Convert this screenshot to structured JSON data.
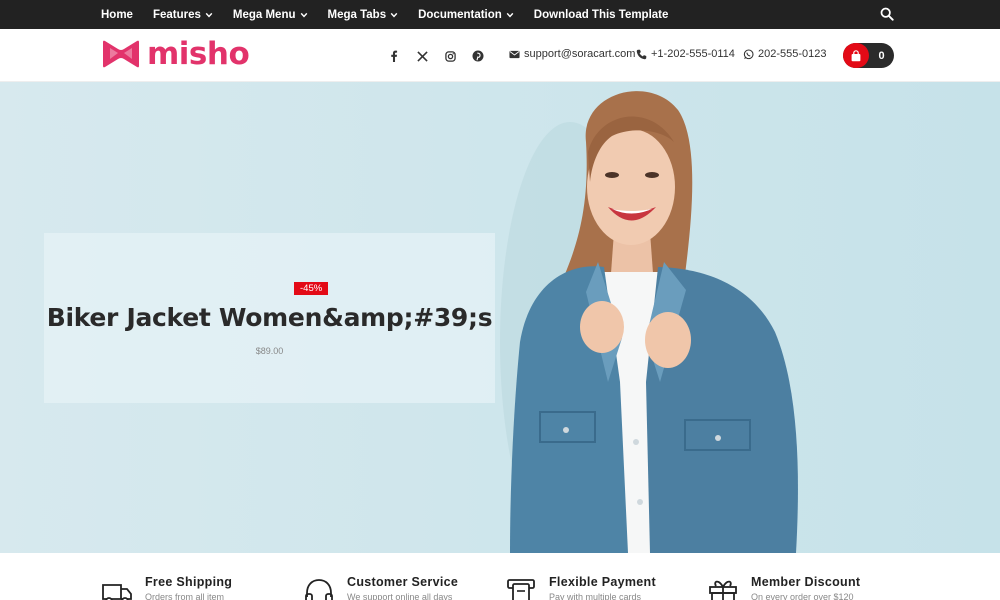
{
  "nav": {
    "items": [
      {
        "label": "Home",
        "dropdown": false
      },
      {
        "label": "Features",
        "dropdown": true
      },
      {
        "label": "Mega Menu",
        "dropdown": true
      },
      {
        "label": "Mega Tabs",
        "dropdown": true
      },
      {
        "label": "Documentation",
        "dropdown": true
      },
      {
        "label": "Download This Template",
        "dropdown": false
      }
    ],
    "search_icon": "search-icon"
  },
  "header": {
    "logo_text": "misho",
    "brand_color": "#e2336b",
    "socials": [
      "facebook-icon",
      "x-icon",
      "instagram-icon",
      "pinterest-icon"
    ],
    "email": "support@soracart.com",
    "phone": "+1-202-555-0114",
    "whatsapp": "202-555-0123",
    "cart_count": "0",
    "cart_color": "#e30a16"
  },
  "hero": {
    "badge": "-45%",
    "title": "Biker Jacket Women&amp;#39;s",
    "price": "$89.00"
  },
  "features": [
    {
      "title": "Free Shipping",
      "desc": "Orders from all item",
      "icon": "truck-icon"
    },
    {
      "title": "Customer Service",
      "desc": "We support online all days",
      "icon": "headphones-icon"
    },
    {
      "title": "Flexible Payment",
      "desc": "Pay with multiple cards",
      "icon": "payment-icon"
    },
    {
      "title": "Member Discount",
      "desc": "On every order over $120",
      "icon": "gift-icon"
    }
  ]
}
